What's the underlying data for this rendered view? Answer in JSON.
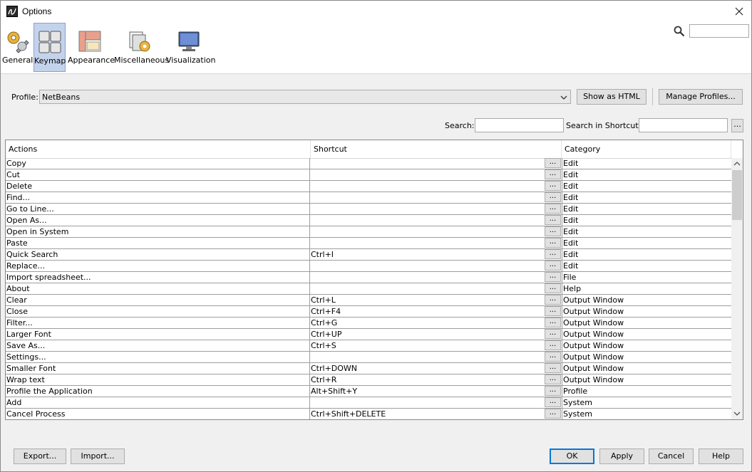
{
  "window": {
    "title": "Options"
  },
  "categories": [
    {
      "label": "General",
      "icon": "gears-icon",
      "selected": false
    },
    {
      "label": "Keymap",
      "icon": "keyboard-icon",
      "selected": true
    },
    {
      "label": "Appearance",
      "icon": "layout-icon",
      "selected": false
    },
    {
      "label": "Miscellaneous",
      "icon": "misc-icon",
      "selected": false
    },
    {
      "label": "Visualization",
      "icon": "monitor-icon",
      "selected": false
    }
  ],
  "profile": {
    "label": "Profile:",
    "value": "NetBeans",
    "show_html_label": "Show as HTML",
    "manage_label": "Manage Profiles..."
  },
  "search": {
    "label": "Search:",
    "value": "",
    "shortcuts_label": "Search in Shortcuts:",
    "shortcuts_value": "",
    "more_label": "..."
  },
  "table": {
    "columns": [
      "Actions",
      "Shortcut",
      "Category"
    ],
    "edit_label": "...",
    "rows": [
      {
        "action": "Copy",
        "shortcut": "",
        "category": "Edit"
      },
      {
        "action": "Cut",
        "shortcut": "",
        "category": "Edit"
      },
      {
        "action": "Delete",
        "shortcut": "",
        "category": "Edit"
      },
      {
        "action": "Find...",
        "shortcut": "",
        "category": "Edit"
      },
      {
        "action": "Go to Line...",
        "shortcut": "",
        "category": "Edit"
      },
      {
        "action": "Open As...",
        "shortcut": "",
        "category": "Edit"
      },
      {
        "action": "Open in System",
        "shortcut": "",
        "category": "Edit"
      },
      {
        "action": "Paste",
        "shortcut": "",
        "category": "Edit"
      },
      {
        "action": "Quick Search",
        "shortcut": "Ctrl+I",
        "category": "Edit"
      },
      {
        "action": "Replace...",
        "shortcut": "",
        "category": "Edit"
      },
      {
        "action": "Import spreadsheet...",
        "shortcut": "",
        "category": "File"
      },
      {
        "action": "About",
        "shortcut": "",
        "category": "Help"
      },
      {
        "action": "Clear",
        "shortcut": "Ctrl+L",
        "category": "Output Window"
      },
      {
        "action": "Close",
        "shortcut": "Ctrl+F4",
        "category": "Output Window"
      },
      {
        "action": "Filter...",
        "shortcut": "Ctrl+G",
        "category": "Output Window"
      },
      {
        "action": "Larger Font",
        "shortcut": "Ctrl+UP",
        "category": "Output Window"
      },
      {
        "action": "Save As...",
        "shortcut": "Ctrl+S",
        "category": "Output Window"
      },
      {
        "action": "Settings...",
        "shortcut": "",
        "category": "Output Window"
      },
      {
        "action": "Smaller Font",
        "shortcut": "Ctrl+DOWN",
        "category": "Output Window"
      },
      {
        "action": "Wrap text",
        "shortcut": "Ctrl+R",
        "category": "Output Window"
      },
      {
        "action": "Profile the Application",
        "shortcut": "Alt+Shift+Y",
        "category": "Profile"
      },
      {
        "action": "Add",
        "shortcut": "",
        "category": "System"
      },
      {
        "action": "Cancel Process",
        "shortcut": "Ctrl+Shift+DELETE",
        "category": "System"
      }
    ]
  },
  "footer": {
    "export_label": "Export...",
    "import_label": "Import...",
    "ok_label": "OK",
    "apply_label": "Apply",
    "cancel_label": "Cancel",
    "help_label": "Help"
  },
  "colors": {
    "selected_category_bg": "#c4d3ec",
    "default_button_border": "#0078d7"
  }
}
